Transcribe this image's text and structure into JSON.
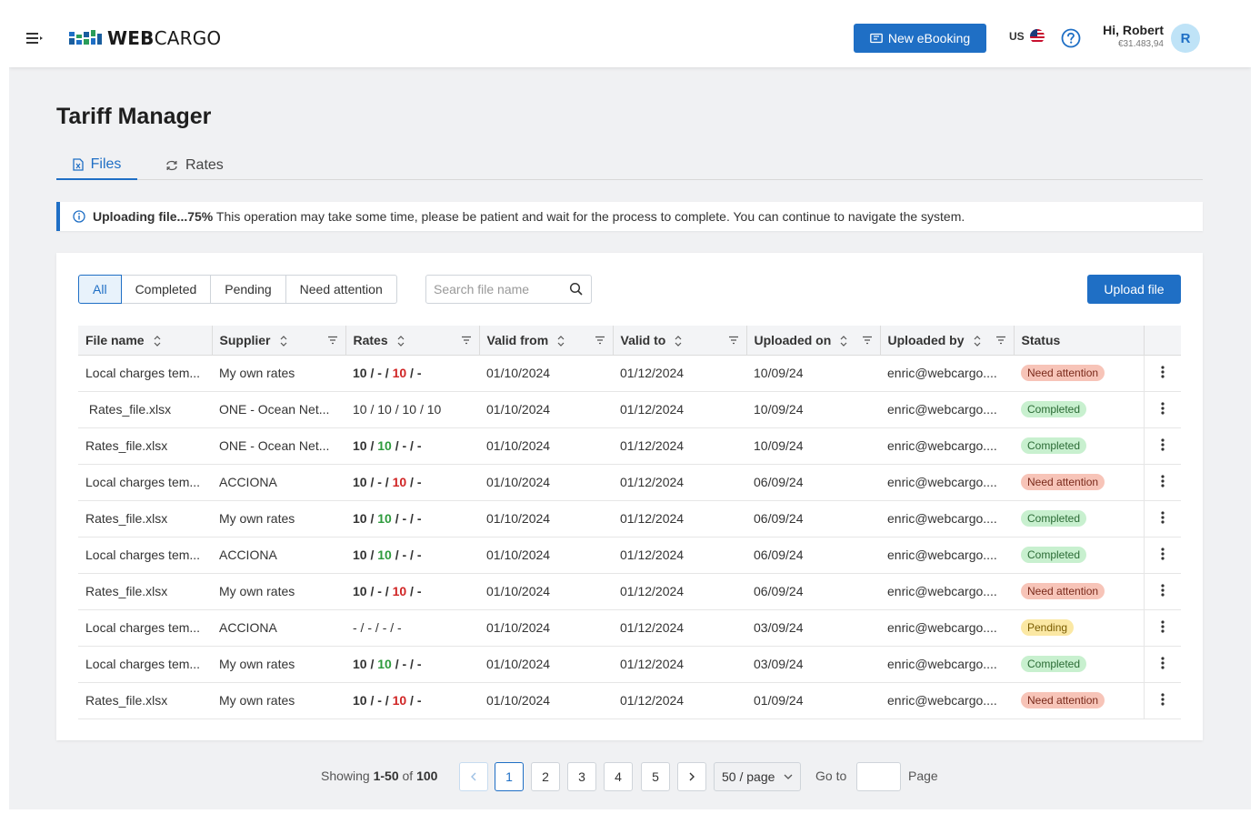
{
  "app": {
    "logo_prefix": "WEB",
    "logo_suffix": "CARGO"
  },
  "header": {
    "new_ebooking_label": "New eBooking",
    "lang": "US",
    "greeting": "Hi, Robert",
    "balance": "€31.483,94",
    "avatar_initial": "R"
  },
  "page": {
    "title": "Tariff Manager"
  },
  "tabs": [
    {
      "label": "Files"
    },
    {
      "label": "Rates"
    }
  ],
  "alert": {
    "bold": "Uploading file...75%",
    "message": "This operation may take some time, please be patient and wait for the process to complete. You can continue to navigate the system."
  },
  "filters": [
    {
      "label": "All"
    },
    {
      "label": "Completed"
    },
    {
      "label": "Pending"
    },
    {
      "label": "Need attention"
    }
  ],
  "search": {
    "placeholder": "Search file name"
  },
  "upload_label": "Upload file",
  "table": {
    "columns": [
      "File name",
      "Supplier",
      "Rates",
      "Valid from",
      "Valid to",
      "Uploaded on",
      "Uploaded by",
      "Status"
    ],
    "rows": [
      {
        "file": "Local charges tem...",
        "supplier": "My own rates",
        "rates": [
          {
            "t": "10",
            "c": "d"
          },
          {
            "t": "-",
            "c": "d"
          },
          {
            "t": "10",
            "c": "r"
          },
          {
            "t": "-",
            "c": "d"
          }
        ],
        "rates_bold": true,
        "valid_from": "01/10/2024",
        "valid_to": "01/12/2024",
        "uploaded_on": "10/09/24",
        "uploaded_by": "enric@webcargo....",
        "status": "Need attention",
        "status_type": "att"
      },
      {
        "file": " Rates_file.xlsx",
        "supplier": "ONE - Ocean Net...",
        "rates": [
          {
            "t": "10",
            "c": "n"
          },
          {
            "t": "10",
            "c": "n"
          },
          {
            "t": "10",
            "c": "n"
          },
          {
            "t": "10",
            "c": "n"
          }
        ],
        "rates_bold": false,
        "valid_from": "01/10/2024",
        "valid_to": "01/12/2024",
        "uploaded_on": "10/09/24",
        "uploaded_by": "enric@webcargo....",
        "status": "Completed",
        "status_type": "comp"
      },
      {
        "file": "Rates_file.xlsx",
        "supplier": "ONE - Ocean Net...",
        "rates": [
          {
            "t": "10",
            "c": "d"
          },
          {
            "t": "10",
            "c": "g"
          },
          {
            "t": "-",
            "c": "d"
          },
          {
            "t": "-",
            "c": "d"
          }
        ],
        "rates_bold": true,
        "valid_from": "01/10/2024",
        "valid_to": "01/12/2024",
        "uploaded_on": "10/09/24",
        "uploaded_by": "enric@webcargo....",
        "status": "Completed",
        "status_type": "comp"
      },
      {
        "file": "Local charges tem...",
        "supplier": "ACCIONA",
        "rates": [
          {
            "t": "10",
            "c": "d"
          },
          {
            "t": "-",
            "c": "d"
          },
          {
            "t": "10",
            "c": "r"
          },
          {
            "t": "-",
            "c": "d"
          }
        ],
        "rates_bold": true,
        "valid_from": "01/10/2024",
        "valid_to": "01/12/2024",
        "uploaded_on": "06/09/24",
        "uploaded_by": "enric@webcargo....",
        "status": "Need attention",
        "status_type": "att"
      },
      {
        "file": "Rates_file.xlsx",
        "supplier": "My own rates",
        "rates": [
          {
            "t": "10",
            "c": "d"
          },
          {
            "t": "10",
            "c": "g"
          },
          {
            "t": "-",
            "c": "d"
          },
          {
            "t": "-",
            "c": "d"
          }
        ],
        "rates_bold": true,
        "valid_from": "01/10/2024",
        "valid_to": "01/12/2024",
        "uploaded_on": "06/09/24",
        "uploaded_by": "enric@webcargo....",
        "status": "Completed",
        "status_type": "comp"
      },
      {
        "file": "Local charges tem...",
        "supplier": "ACCIONA",
        "rates": [
          {
            "t": "10",
            "c": "d"
          },
          {
            "t": "10",
            "c": "g"
          },
          {
            "t": "-",
            "c": "d"
          },
          {
            "t": "-",
            "c": "d"
          }
        ],
        "rates_bold": true,
        "valid_from": "01/10/2024",
        "valid_to": "01/12/2024",
        "uploaded_on": "06/09/24",
        "uploaded_by": "enric@webcargo....",
        "status": "Completed",
        "status_type": "comp"
      },
      {
        "file": "Rates_file.xlsx",
        "supplier": "My own rates",
        "rates": [
          {
            "t": "10",
            "c": "d"
          },
          {
            "t": "-",
            "c": "d"
          },
          {
            "t": "10",
            "c": "r"
          },
          {
            "t": "-",
            "c": "d"
          }
        ],
        "rates_bold": true,
        "valid_from": "01/10/2024",
        "valid_to": "01/12/2024",
        "uploaded_on": "06/09/24",
        "uploaded_by": "enric@webcargo....",
        "status": "Need attention",
        "status_type": "att"
      },
      {
        "file": "Local charges tem...",
        "supplier": "ACCIONA",
        "rates": [
          {
            "t": "-",
            "c": "n"
          },
          {
            "t": "-",
            "c": "n"
          },
          {
            "t": "-",
            "c": "n"
          },
          {
            "t": "-",
            "c": "n"
          }
        ],
        "rates_bold": false,
        "valid_from": "01/10/2024",
        "valid_to": "01/12/2024",
        "uploaded_on": "03/09/24",
        "uploaded_by": "enric@webcargo....",
        "status": "Pending",
        "status_type": "pend"
      },
      {
        "file": "Local charges tem...",
        "supplier": "My own rates",
        "rates": [
          {
            "t": "10",
            "c": "d"
          },
          {
            "t": "10",
            "c": "g"
          },
          {
            "t": "-",
            "c": "d"
          },
          {
            "t": "-",
            "c": "d"
          }
        ],
        "rates_bold": true,
        "valid_from": "01/10/2024",
        "valid_to": "01/12/2024",
        "uploaded_on": "03/09/24",
        "uploaded_by": "enric@webcargo....",
        "status": "Completed",
        "status_type": "comp"
      },
      {
        "file": "Rates_file.xlsx",
        "supplier": "My own rates",
        "rates": [
          {
            "t": "10",
            "c": "d"
          },
          {
            "t": "-",
            "c": "d"
          },
          {
            "t": "10",
            "c": "r"
          },
          {
            "t": "-",
            "c": "d"
          }
        ],
        "rates_bold": true,
        "valid_from": "01/10/2024",
        "valid_to": "01/12/2024",
        "uploaded_on": "01/09/24",
        "uploaded_by": "enric@webcargo....",
        "status": "Need attention",
        "status_type": "att"
      }
    ]
  },
  "pagination": {
    "showing_prefix": "Showing",
    "range": "1-50",
    "of": "of",
    "total": "100",
    "pages": [
      "1",
      "2",
      "3",
      "4",
      "5"
    ],
    "current_page": "1",
    "page_size": "50 / page",
    "goto_label": "Go to",
    "page_label": "Page"
  },
  "colors": {
    "primary": "#1f6fc5",
    "attention": "#f7c4b8",
    "completed": "#c8f0cf",
    "pending": "#fbe8a4",
    "rate_red": "#d02525",
    "rate_green": "#2e9b3d"
  }
}
